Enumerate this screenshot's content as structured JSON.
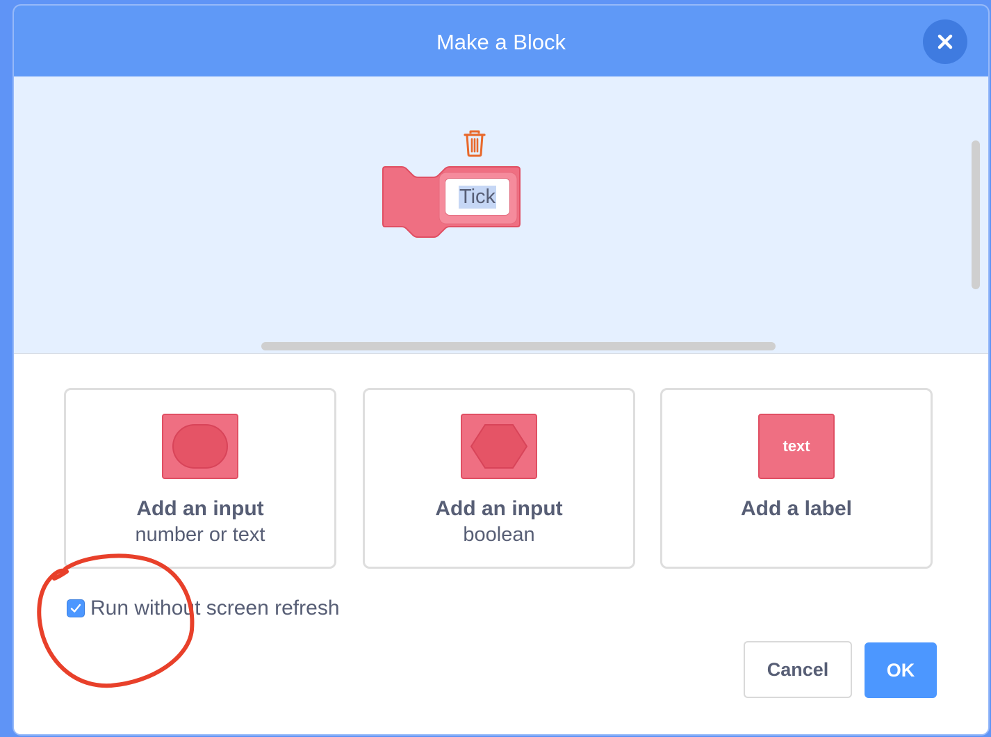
{
  "dialog": {
    "title": "Make a Block",
    "close_icon": "close-icon"
  },
  "block_preview": {
    "input_text": "Tick",
    "delete_icon": "trash-icon",
    "block_color": "#ef6f82"
  },
  "options": [
    {
      "title": "Add an input",
      "subtitle": "number or text",
      "icon": "oval-input-icon"
    },
    {
      "title": "Add an input",
      "subtitle": "boolean",
      "icon": "hexagon-input-icon"
    },
    {
      "title": "Add a label",
      "subtitle": "",
      "icon_text": "text",
      "icon": "label-icon"
    }
  ],
  "run_without_refresh": {
    "label": "Run without screen refresh",
    "checked": true
  },
  "buttons": {
    "cancel": "Cancel",
    "ok": "OK"
  },
  "colors": {
    "header": "#5f99f7",
    "accent": "#4c97ff",
    "block": "#ef6f82",
    "annotation": "#e8402a",
    "trash": "#e8692c"
  }
}
